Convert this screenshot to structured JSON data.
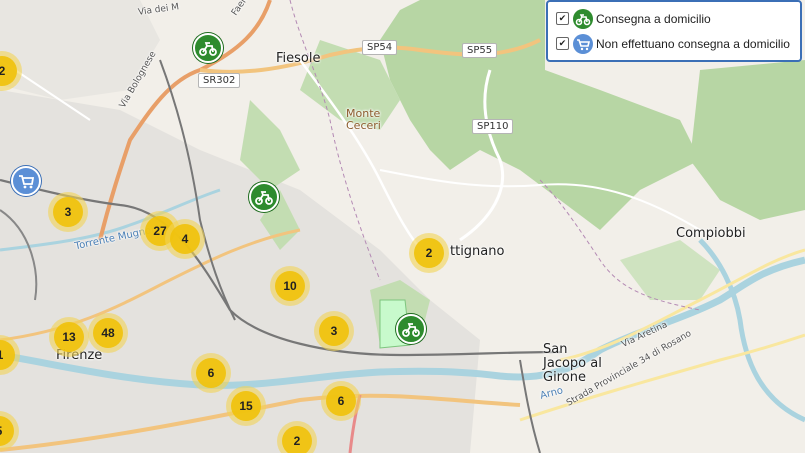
{
  "legend": {
    "items": [
      {
        "label": "Consegna a domicilio",
        "checked": true,
        "check": "✔",
        "icon": "delivery-scooter-icon",
        "color": "#2e8b2e"
      },
      {
        "label": "Non effettuano consegna a domicilio",
        "checked": true,
        "check": "✔",
        "icon": "shopping-cart-icon",
        "color": "#5b8fd6"
      }
    ]
  },
  "map_labels": {
    "fiesole": "Fiesole",
    "monte_ceceri": "Monte Ceceri",
    "firenze": "Firenze",
    "settignano": "ttignano",
    "compiobbi": "Compiobbi",
    "san_jacopo": "San Jacopo al Girone",
    "sp54": "SP54",
    "sp55": "SP55",
    "sp110": "SP110",
    "sr302": "SR302",
    "via_bolognese": "Via Bolognese",
    "torrente_mugnone": "Torrente Mugnone",
    "via_dei_m": "Via dei M",
    "strada_provinciale": "Strada Provinciale 34 di Rosano",
    "via_aretina": "Via Aretina",
    "arno": "Arno",
    "faentina": "Faentina Nuova"
  },
  "clusters": [
    {
      "count": "2"
    },
    {
      "count": "3"
    },
    {
      "count": "27"
    },
    {
      "count": "4"
    },
    {
      "count": "2"
    },
    {
      "count": "10"
    },
    {
      "count": "3"
    },
    {
      "count": "13"
    },
    {
      "count": "48"
    },
    {
      "count": "1"
    },
    {
      "count": "6"
    },
    {
      "count": "15"
    },
    {
      "count": "6"
    },
    {
      "count": "2"
    },
    {
      "count": "5"
    }
  ],
  "colors": {
    "land": "#f2efe9",
    "forest": "#add19e",
    "urban": "#e0dfdf",
    "river": "#aad3df",
    "major_road": "#fcd6a4",
    "rail": "#777777",
    "cluster_outer": "#f1d357",
    "cluster_inner": "#f0c20c"
  }
}
